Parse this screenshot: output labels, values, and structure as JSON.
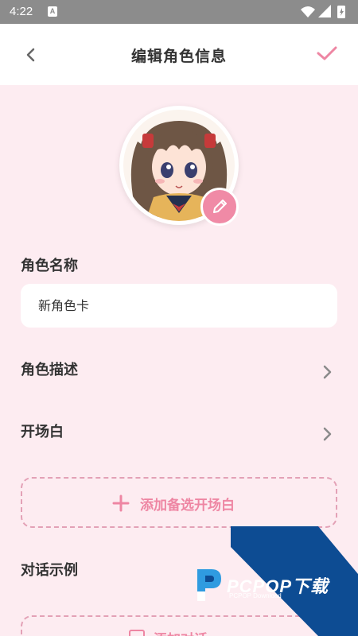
{
  "status_bar": {
    "time": "4:22",
    "notification_icon": "A",
    "icons": [
      "wifi-icon",
      "signal-icon",
      "battery-icon"
    ]
  },
  "header": {
    "title": "编辑角色信息",
    "back_icon": "chevron-left-icon",
    "confirm_icon": "check-icon"
  },
  "avatar": {
    "edit_icon": "pencil-icon"
  },
  "form": {
    "name_label": "角色名称",
    "name_value": "新角色卡",
    "description_label": "角色描述",
    "opening_label": "开场白",
    "add_alt_opening_label": "添加备选开场白",
    "dialogue_examples_label": "对话示例",
    "add_dialogue_label": "添加对话"
  },
  "watermark": {
    "brand": "PCPOP下载",
    "sub": "PCPOP Download"
  },
  "colors": {
    "background": "#fdecf1",
    "accent": "#ee86a3",
    "dashed_border": "#e3a1b6",
    "watermark_blue": "#0d4c93"
  }
}
